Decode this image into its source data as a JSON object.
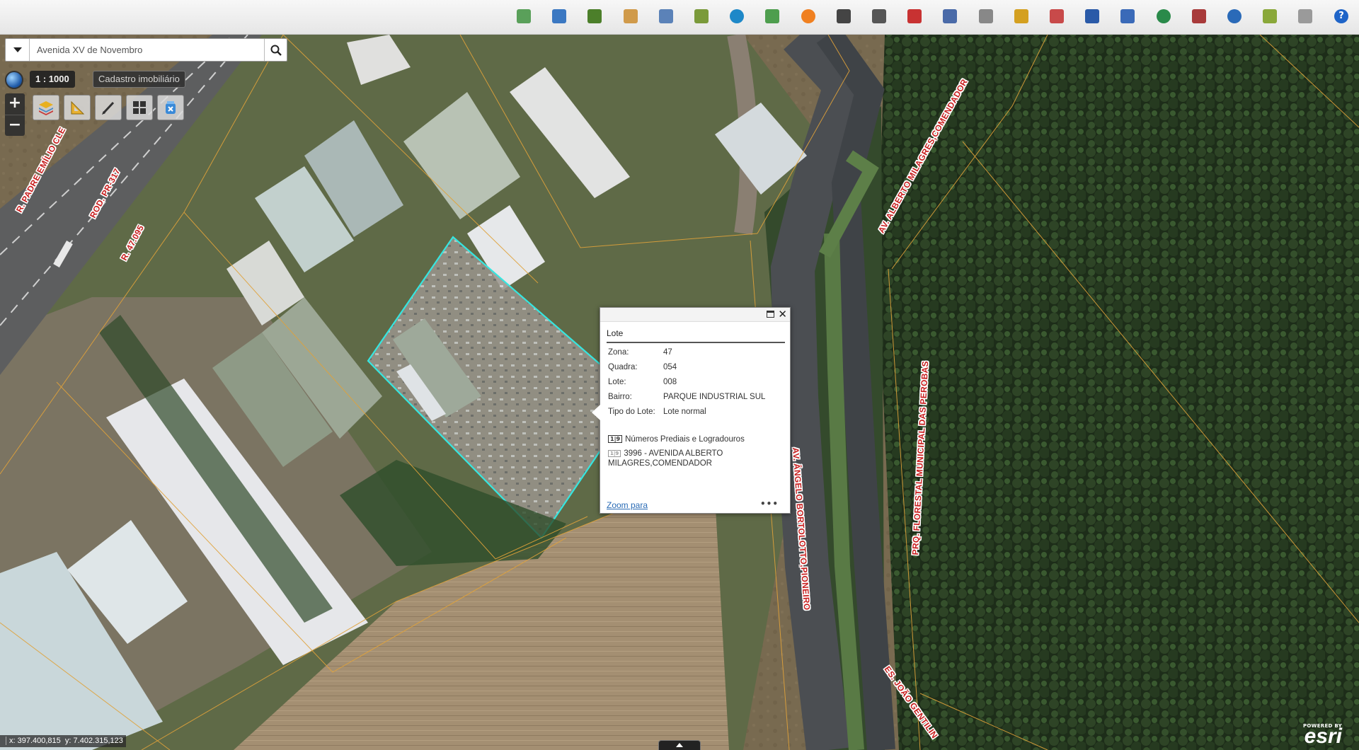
{
  "toolbar": {
    "buttons": [
      {
        "name": "zoom-extent-icon",
        "color": "#5aa05a"
      },
      {
        "name": "magnifier-doc-icon",
        "color": "#3b78c2"
      },
      {
        "name": "layers-stack-icon",
        "color": "#4c7f2a"
      },
      {
        "name": "hand-pan-icon",
        "color": "#d09a4a"
      },
      {
        "name": "coordinate-icon",
        "color": "#5b82b8"
      },
      {
        "name": "document-list-icon",
        "color": "#7a9a3a"
      },
      {
        "name": "target-search-icon",
        "color": "#1e88c8"
      },
      {
        "name": "map-puzzle-icon",
        "color": "#4e9e4e"
      },
      {
        "name": "orange-circle-icon",
        "color": "#f08020"
      },
      {
        "name": "binoculars-icon",
        "color": "#444444"
      },
      {
        "name": "binoculars-alt-icon",
        "color": "#555555"
      },
      {
        "name": "location-pin-icon",
        "color": "#c83232"
      },
      {
        "name": "list-icon",
        "color": "#4a6aa8"
      },
      {
        "name": "pencil-icon",
        "color": "#888888"
      },
      {
        "name": "ruler-triangle-icon",
        "color": "#d4a020"
      },
      {
        "name": "users-icon",
        "color": "#c84a4a"
      },
      {
        "name": "car-icon",
        "color": "#2a5aa8"
      },
      {
        "name": "printer-icon",
        "color": "#3a6ab8"
      },
      {
        "name": "globe-icon",
        "color": "#2a8a4a"
      },
      {
        "name": "book-icon",
        "color": "#a83a3a"
      },
      {
        "name": "globe-search-icon",
        "color": "#2a6ab8"
      },
      {
        "name": "image-export-icon",
        "color": "#8aa83a"
      },
      {
        "name": "dwg-file-icon",
        "color": "#9a9a9a"
      },
      {
        "name": "help-icon",
        "color": "#1e64c8"
      }
    ]
  },
  "search": {
    "value": "Avenida XV de Novembro"
  },
  "scale": {
    "label": "1 :  1000"
  },
  "layer_label": "Cadastro imobiliário",
  "zoom": {
    "in": "+",
    "out": "−"
  },
  "map_tools": [
    {
      "name": "layers-button",
      "color": "#e0a020"
    },
    {
      "name": "measure-button",
      "color": "#d4a020"
    },
    {
      "name": "draw-button",
      "color": "#666666"
    },
    {
      "name": "grid-button",
      "color": "#444444"
    },
    {
      "name": "clear-button",
      "color": "#2a7ac8"
    }
  ],
  "popup": {
    "title": "Lote",
    "fields": [
      {
        "label": "Zona:",
        "value": "47"
      },
      {
        "label": "Quadra:",
        "value": "054"
      },
      {
        "label": "Lote:",
        "value": "008"
      },
      {
        "label": "Bairro:",
        "value": "PARQUE INDUSTRIAL SUL"
      },
      {
        "label": "Tipo do Lote:",
        "value": "Lote normal"
      }
    ],
    "section_icon": "1|9",
    "section_title": "Números Prediais e Logradouros",
    "address_icon": "1|9",
    "address_line1": "3996 - AVENIDA ALBERTO",
    "address_line2": "MILAGRES,COMENDADOR",
    "zoom_link": "Zoom para",
    "more": "•••"
  },
  "streets": [
    {
      "id": "padre-emilio",
      "text": "R. PADRE EMÍLIO CLE"
    },
    {
      "id": "rod-pr",
      "text": "ROD. PR-317"
    },
    {
      "id": "r47",
      "text": "R. 47.095"
    },
    {
      "id": "alberto",
      "text": "AV. ALBERTO MILAGRES,COMENDADOR"
    },
    {
      "id": "perobas",
      "text": "PRQ. FLORESTAL MUNICIPAL DAS PEROBAS"
    },
    {
      "id": "angelo",
      "text": "AV. ÂNGELO BORTOLOTTO,PIONEIRO"
    },
    {
      "id": "gentilin",
      "text": "ES. JOÃO GENTILIN"
    }
  ],
  "coords": {
    "x": "x: 397.400,815",
    "y": "y: 7.402.315,123"
  },
  "attribution": {
    "powered": "POWERED BY",
    "brand": "esri"
  }
}
